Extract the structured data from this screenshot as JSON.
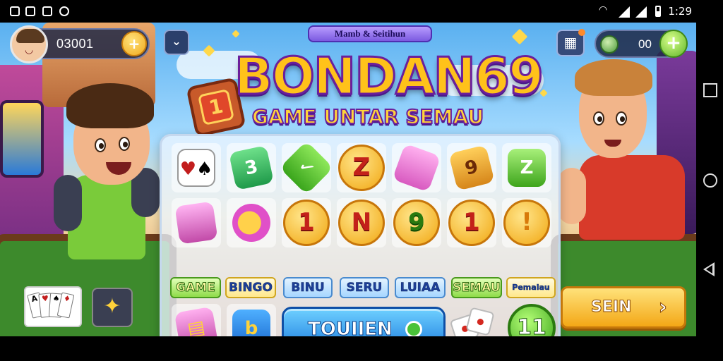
{
  "status_bar": {
    "time": "1:29",
    "left_icons": [
      "notification-icon",
      "notification-icon",
      "notification-icon",
      "notification-icon"
    ],
    "right_icons": [
      "wifi-icon",
      "signal-icon",
      "signal-icon",
      "battery-icon"
    ]
  },
  "hud": {
    "coins": "03001",
    "coin_add": "+",
    "gems": "00",
    "gems_add": "+"
  },
  "title": {
    "ribbon": "Mamb & Seitihun",
    "logo": "BONDAN69",
    "tagline": "GAME UNTAR SEMAU",
    "tile_number": "1"
  },
  "grid": {
    "row1": [
      "",
      "3",
      "✓",
      "Z",
      "",
      "9",
      "Z"
    ],
    "row2": [
      "",
      "",
      "1",
      "N",
      "9",
      "1",
      "!"
    ]
  },
  "categories": [
    "GAME",
    "BINGO",
    "BINU",
    "SERU",
    "LUIAA",
    "SEMAU",
    "Pemalau"
  ],
  "bottom_row": {
    "start_label": "TOUIIEN",
    "letter_tile": "b",
    "badge": "11"
  },
  "right_button": {
    "label": "SEIN",
    "arrow": "›"
  },
  "colors": {
    "accent_yellow": "#FFC21A",
    "accent_purple": "#6B1F9C",
    "accent_blue": "#1E7FE0",
    "accent_green": "#5FB629"
  }
}
